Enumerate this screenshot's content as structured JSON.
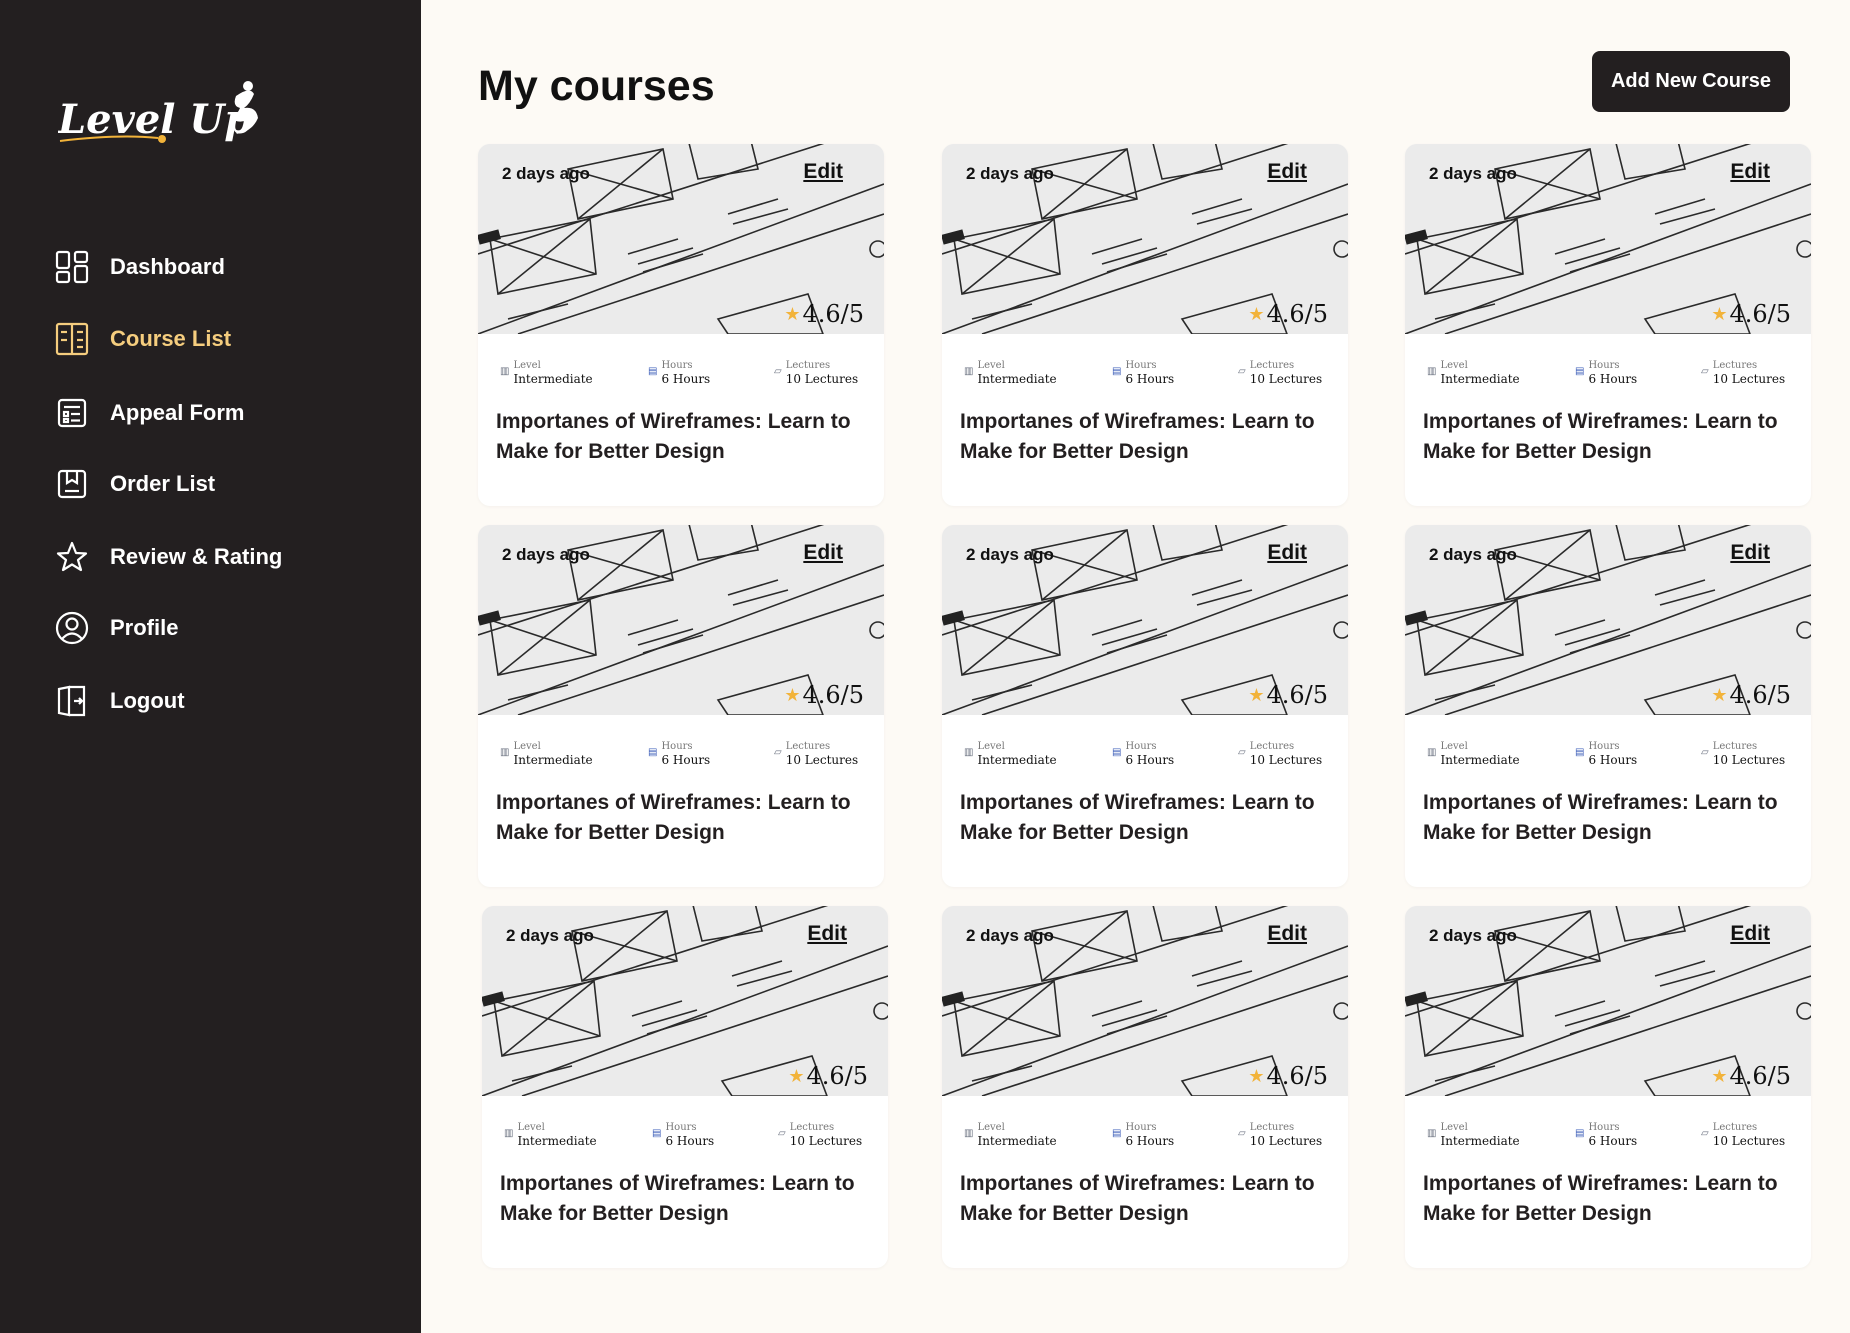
{
  "brand": {
    "name": "Level Up",
    "accent": "#f5cd7e",
    "sidebar_bg": "#231f20"
  },
  "sidebar": {
    "items": [
      {
        "label": "Dashboard",
        "icon": "dashboard-grid-icon",
        "active": false
      },
      {
        "label": "Course List",
        "icon": "book-columns-icon",
        "active": true
      },
      {
        "label": "Appeal Form",
        "icon": "form-checklist-icon",
        "active": false
      },
      {
        "label": "Order List",
        "icon": "bookmark-box-icon",
        "active": false
      },
      {
        "label": "Review & Rating",
        "icon": "star-icon",
        "active": false
      },
      {
        "label": "Profile",
        "icon": "user-circle-icon",
        "active": false
      },
      {
        "label": "Logout",
        "icon": "logout-door-icon",
        "active": false
      }
    ]
  },
  "main": {
    "title": "My courses",
    "add_button": "Add New Course"
  },
  "courses": [
    {
      "posted": "2 days ago",
      "edit_label": "Edit",
      "rating": "4.6/5",
      "level_label": "Level",
      "level": "Intermediate",
      "hours_label": "Hours",
      "hours": "6 Hours",
      "lectures_label": "Lectures",
      "lectures": "10 Lectures",
      "title": "Importanes of Wireframes: Learn to Make for Better Design"
    },
    {
      "posted": "2 days ago",
      "edit_label": "Edit",
      "rating": "4.6/5",
      "level_label": "Level",
      "level": "Intermediate",
      "hours_label": "Hours",
      "hours": "6 Hours",
      "lectures_label": "Lectures",
      "lectures": "10 Lectures",
      "title": "Importanes of Wireframes: Learn to Make for Better Design"
    },
    {
      "posted": "2 days ago",
      "edit_label": "Edit",
      "rating": "4.6/5",
      "level_label": "Level",
      "level": "Intermediate",
      "hours_label": "Hours",
      "hours": "6 Hours",
      "lectures_label": "Lectures",
      "lectures": "10 Lectures",
      "title": "Importanes of Wireframes: Learn to Make for Better Design"
    },
    {
      "posted": "2 days ago",
      "edit_label": "Edit",
      "rating": "4.6/5",
      "level_label": "Level",
      "level": "Intermediate",
      "hours_label": "Hours",
      "hours": "6 Hours",
      "lectures_label": "Lectures",
      "lectures": "10 Lectures",
      "title": "Importanes of Wireframes: Learn to Make for Better Design"
    },
    {
      "posted": "2 days ago",
      "edit_label": "Edit",
      "rating": "4.6/5",
      "level_label": "Level",
      "level": "Intermediate",
      "hours_label": "Hours",
      "hours": "6 Hours",
      "lectures_label": "Lectures",
      "lectures": "10 Lectures",
      "title": "Importanes of Wireframes: Learn to Make for Better Design"
    },
    {
      "posted": "2 days ago",
      "edit_label": "Edit",
      "rating": "4.6/5",
      "level_label": "Level",
      "level": "Intermediate",
      "hours_label": "Hours",
      "hours": "6 Hours",
      "lectures_label": "Lectures",
      "lectures": "10 Lectures",
      "title": "Importanes of Wireframes: Learn to Make for Better Design"
    },
    {
      "posted": "2 days ago",
      "edit_label": "Edit",
      "rating": "4.6/5",
      "level_label": "Level",
      "level": "Intermediate",
      "hours_label": "Hours",
      "hours": "6 Hours",
      "lectures_label": "Lectures",
      "lectures": "10 Lectures",
      "title": "Importanes of Wireframes: Learn to Make for Better Design"
    },
    {
      "posted": "2 days ago",
      "edit_label": "Edit",
      "rating": "4.6/5",
      "level_label": "Level",
      "level": "Intermediate",
      "hours_label": "Hours",
      "hours": "6 Hours",
      "lectures_label": "Lectures",
      "lectures": "10 Lectures",
      "title": "Importanes of Wireframes: Learn to Make for Better Design"
    },
    {
      "posted": "2 days ago",
      "edit_label": "Edit",
      "rating": "4.6/5",
      "level_label": "Level",
      "level": "Intermediate",
      "hours_label": "Hours",
      "hours": "6 Hours",
      "lectures_label": "Lectures",
      "lectures": "10 Lectures",
      "title": "Importanes of Wireframes: Learn to Make for Better Design"
    }
  ]
}
